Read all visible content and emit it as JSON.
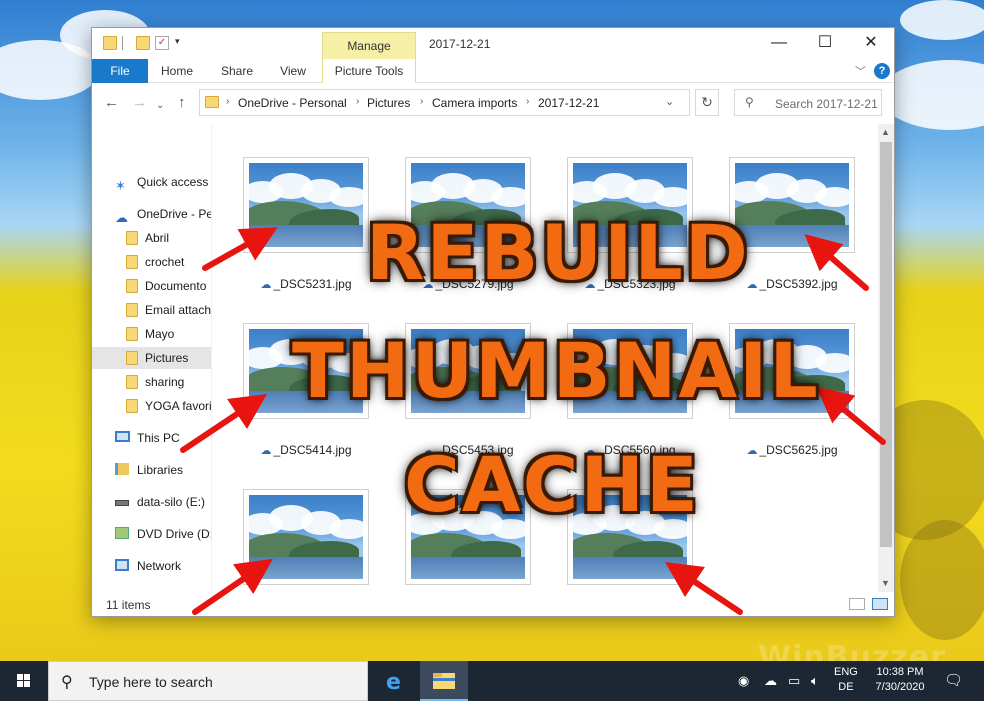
{
  "window": {
    "title": "2017-12-21",
    "manage_tab": "Manage",
    "controls": {
      "minimize": "—",
      "maximize": "☐",
      "close": "✕"
    },
    "ribbon_tabs": [
      "File",
      "Home",
      "Share",
      "View",
      "Picture Tools"
    ],
    "help": "?"
  },
  "address": {
    "crumbs": [
      "OneDrive - Personal",
      "Pictures",
      "Camera imports",
      "2017-12-21"
    ],
    "search_placeholder": "Search 2017-12-21"
  },
  "nav": [
    {
      "label": "Quick access",
      "icon": "star-icon"
    },
    {
      "label": "OneDrive - Pe",
      "icon": "cloud-icon"
    },
    {
      "label": "Abril",
      "icon": "folder-icon"
    },
    {
      "label": "crochet",
      "icon": "folder-icon"
    },
    {
      "label": "Documento",
      "icon": "folder-icon"
    },
    {
      "label": "Email attach",
      "icon": "folder-icon"
    },
    {
      "label": "Mayo",
      "icon": "folder-icon"
    },
    {
      "label": "Pictures",
      "icon": "folder-icon",
      "selected": true
    },
    {
      "label": "sharing",
      "icon": "folder-icon"
    },
    {
      "label": "YOGA favori",
      "icon": "folder-icon"
    },
    {
      "label": "This PC",
      "icon": "monitor-icon"
    },
    {
      "label": "Libraries",
      "icon": "library-icon"
    },
    {
      "label": "data-silo (E:)",
      "icon": "drive-icon"
    },
    {
      "label": "DVD Drive (D:",
      "icon": "dvd-icon"
    },
    {
      "label": "Network",
      "icon": "network-icon"
    }
  ],
  "files": [
    {
      "name": "_DSC5231.jpg"
    },
    {
      "name": "_DSC5279.jpg"
    },
    {
      "name": "_DSC5323.jpg"
    },
    {
      "name": "_DSC5392.jpg"
    },
    {
      "name": "_DSC5414.jpg"
    },
    {
      "name": "_DSC5453.jpg"
    },
    {
      "name": "_DSC5560.jpg"
    },
    {
      "name": "_DSC5625.jpg"
    },
    {
      "name": ""
    },
    {
      "name": ""
    },
    {
      "name": ""
    }
  ],
  "status": {
    "item_count": "11 items"
  },
  "overlay": {
    "line1": "REBUILD",
    "line2": "THUMBNAIL",
    "line3": "CACHE",
    "color": "#f26b12"
  },
  "taskbar": {
    "search_placeholder": "Type here to search",
    "lang_top": "ENG",
    "lang_bottom": "DE",
    "time": "10:38 PM",
    "date": "7/30/2020"
  },
  "watermark": "WinBuzzer"
}
